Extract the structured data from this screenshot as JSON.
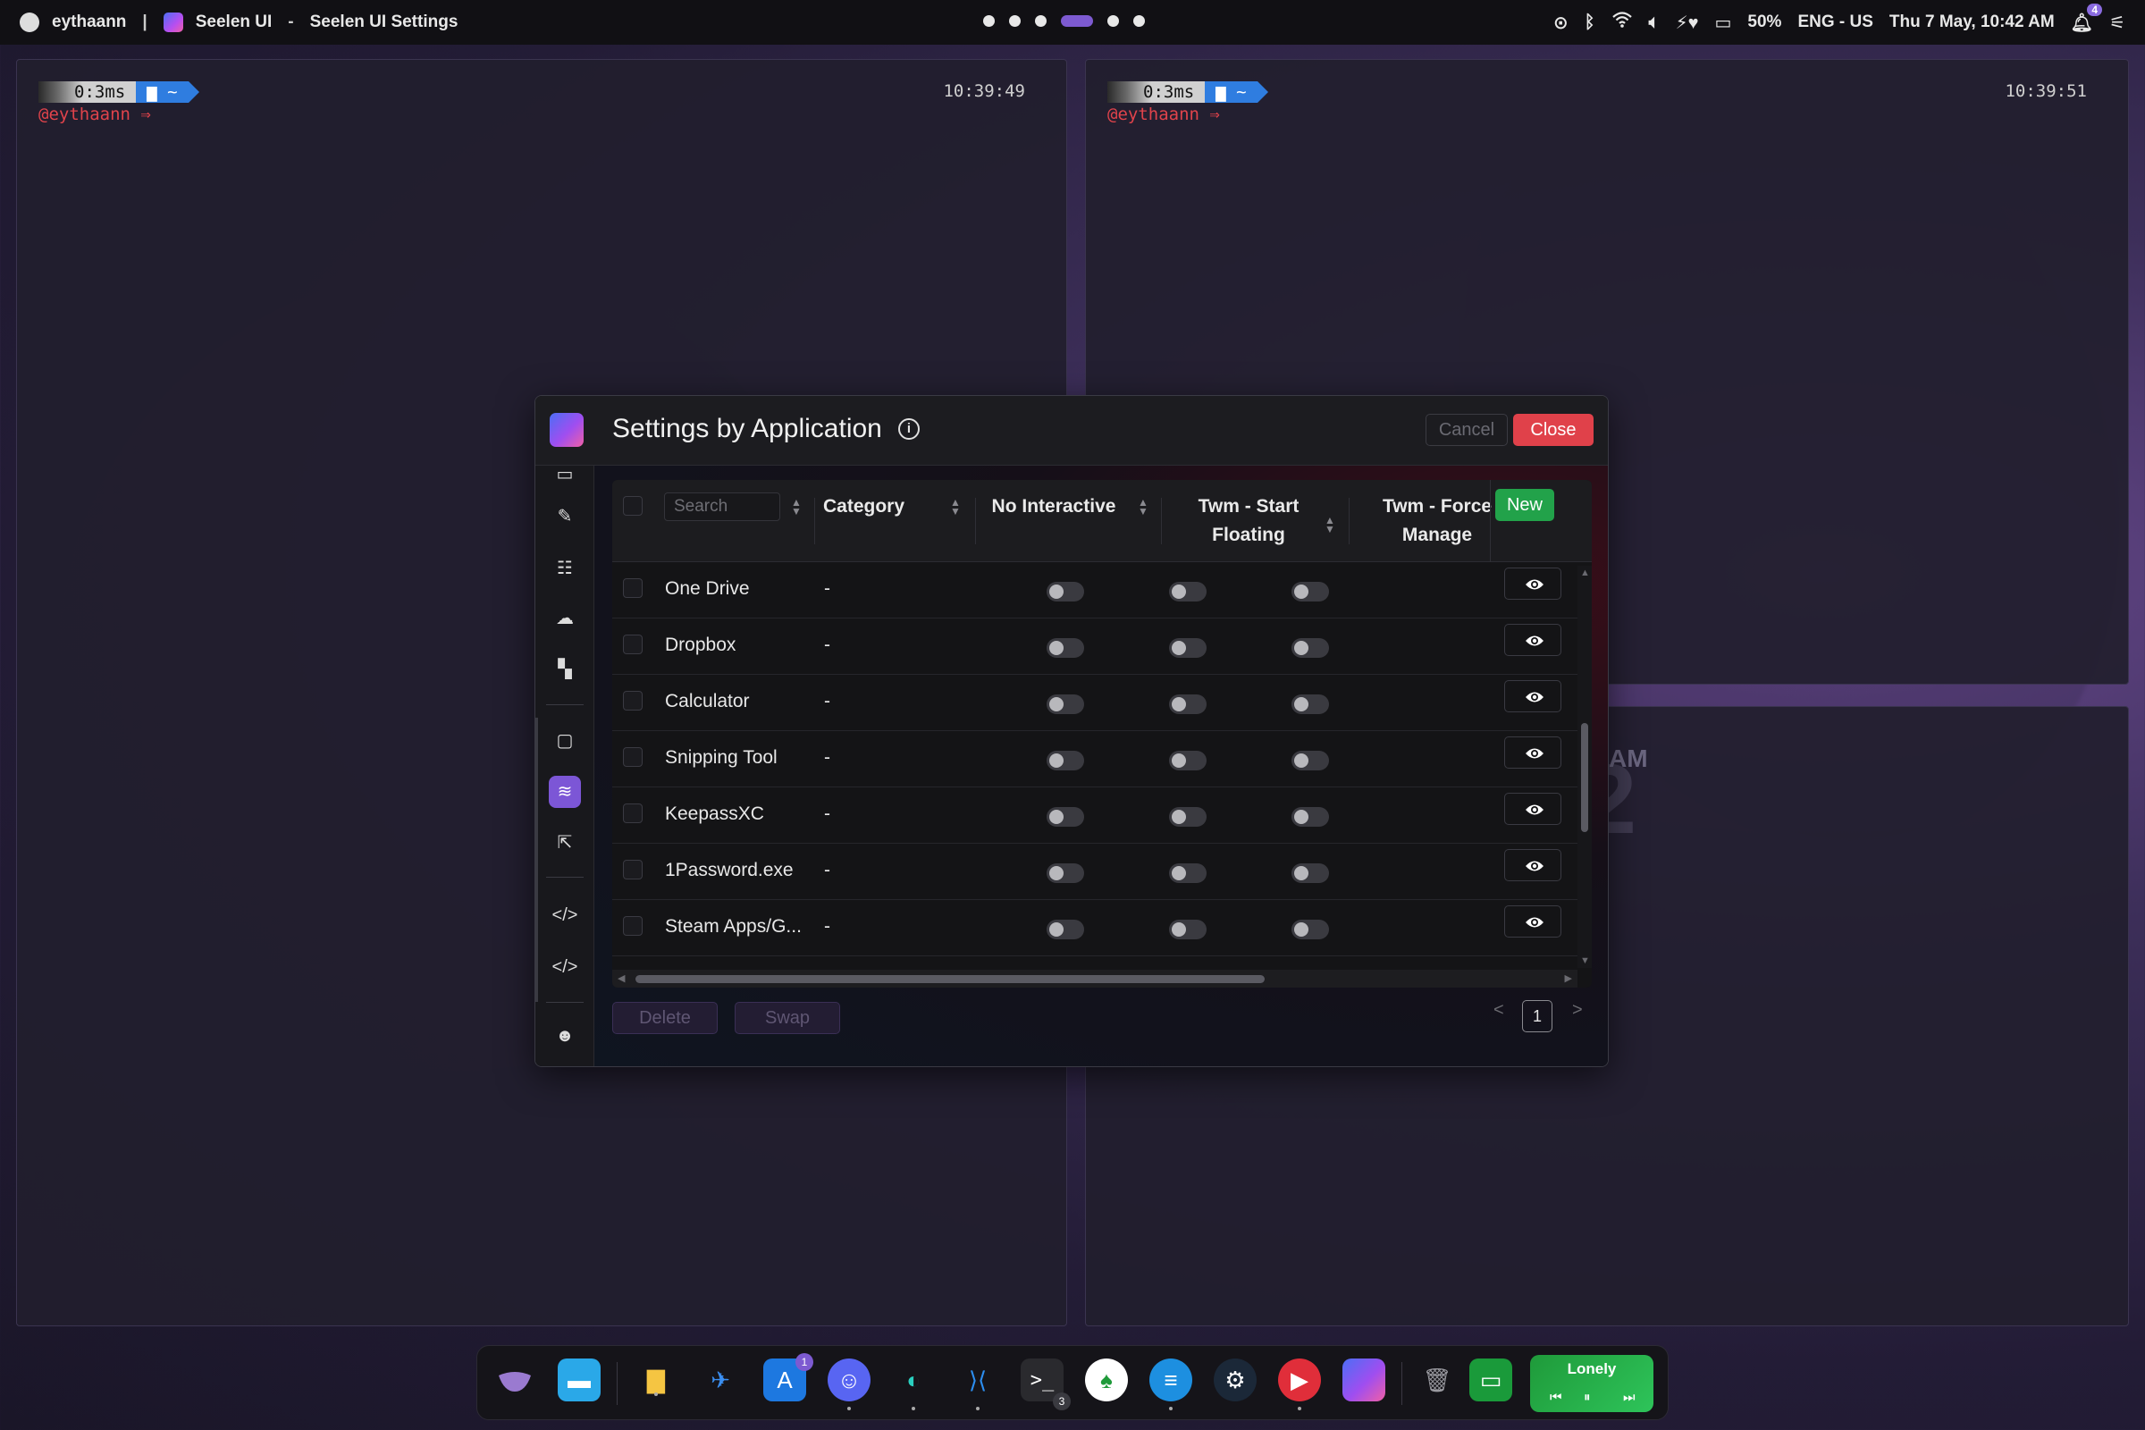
{
  "topbar": {
    "user": "eythaann",
    "separator": "|",
    "app_name": "Seelen UI",
    "dash": "-",
    "window_title": "Seelen UI Settings",
    "battery": "50%",
    "language": "ENG - US",
    "datetime": "Thu 7 May, 10:42 AM",
    "notification_count": "4"
  },
  "terminals": [
    {
      "duration": "0:3ms",
      "dir": "~",
      "user": "@eythaann ⇒",
      "time": "10:39:49"
    },
    {
      "duration": "0:3ms",
      "dir": "~",
      "user": "@eythaann ⇒",
      "time": "10:39:51"
    }
  ],
  "background_clock": {
    "digit": "2",
    "ampm": "AM"
  },
  "dialog": {
    "title": "Settings by Application",
    "info_icon": "i",
    "cancel_label": "Cancel",
    "close_label": "Close",
    "new_label": "New",
    "search_placeholder": "Search",
    "columns": {
      "category": "Category",
      "no_interactive": "No Interactive",
      "start_floating_1": "Twm - Start",
      "start_floating_2": "Floating",
      "force_manage_1": "Twm - Force",
      "force_manage_2": "Manage"
    },
    "rows": [
      {
        "name": "One Drive",
        "category": "-"
      },
      {
        "name": "Dropbox",
        "category": "-"
      },
      {
        "name": "Calculator",
        "category": "-"
      },
      {
        "name": "Snipping Tool",
        "category": "-"
      },
      {
        "name": "KeepassXC",
        "category": "-"
      },
      {
        "name": "1Password.exe",
        "category": "-"
      },
      {
        "name": "Steam Apps/G...",
        "category": "-"
      }
    ],
    "delete_label": "Delete",
    "swap_label": "Swap",
    "page": "1",
    "prev": "<",
    "next": ">"
  },
  "dock": {
    "store_badge": "1",
    "terminal_badge": "3",
    "media_title": "Lonely"
  },
  "colors": {
    "accent": "#7c56d6",
    "close": "#e0414a",
    "new": "#22a24a"
  }
}
